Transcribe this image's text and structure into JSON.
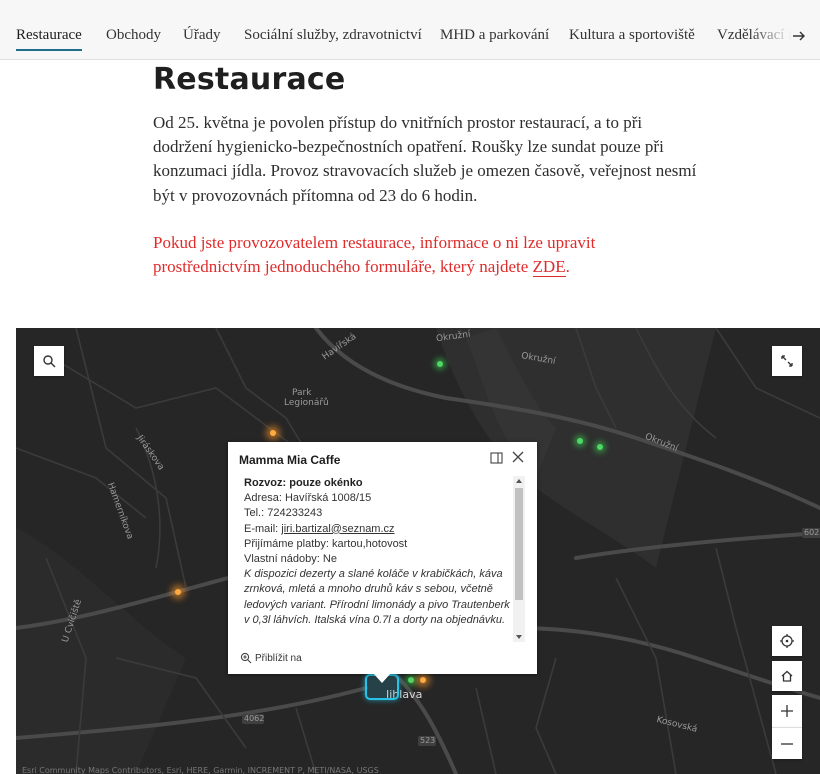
{
  "nav": {
    "tabs": [
      {
        "label": "Restaurace",
        "active": true
      },
      {
        "label": "Obchody"
      },
      {
        "label": "Úřady"
      },
      {
        "label": "Sociální služby, zdravotnictví"
      },
      {
        "label": "MHD a parkování"
      },
      {
        "label": "Kultura a sportoviště"
      },
      {
        "label": "Vzdělávací instituce"
      }
    ]
  },
  "article": {
    "title": "Restaurace",
    "body": "Od 25. května je povolen přístup do vnitřních prostor restaurací, a to při dodržení hygienicko-bezpečnostních opatření. Roušky lze sundat pouze při konzumaci jídla. Provoz stravovacích služeb je omezen časově, veřejnost nesmí být v provozovnách přítomna od 23 do 6 hodin.",
    "notice_text": "Pokud jste provozovatelem restaurace, informace o ni lze upravit prostřednictvím jednoduchého formuláře, který najdete ",
    "notice_link": "ZDE",
    "notice_end": ".",
    "accent_color": "#e02b2b"
  },
  "map": {
    "labels": {
      "okruzni_1": "Okružní",
      "okruzni_2": "Okružní",
      "okruzni_3": "Okružní",
      "havirska": "Havířská",
      "jiraskova": "Jiráskova",
      "hamernikova": "Hamerníkova",
      "u_cvicista": "U Cvičiště",
      "park": "Park",
      "legionaru": "Legionářů",
      "jihlava": "Jihlava",
      "kosovska": "Kosovská",
      "road_602": "602",
      "road_4062": "4062",
      "road_523": "523"
    },
    "attribution": "Esri Community Maps Contributors, Esri, HERE, Garmin, INCREMENT P, METI/NASA, USGS",
    "popup": {
      "title": "Mamma Mia Caffe",
      "heading": "Rozvoz: pouze okénko",
      "address": "Adresa: Havířská 1008/15",
      "phone": "Tel.: 724233243",
      "email_label": "E-mail: ",
      "email": "jiri.bartizal@seznam.cz",
      "payment": "Přijímáme platby: kartou,hotovost",
      "own_containers": "Vlastní nádoby: Ne",
      "description": "K dispozici dezerty a slané koláče v krabičkách, káva zrnková, mletá a mnoho druhů káv s sebou, včetně ledových variant. Přírodní limonády a pivo Trautenberk v 0,3l láhvích. Italská vína 0.7l a dorty na objednávku.",
      "zoom_label": "Přiblížit na"
    }
  }
}
